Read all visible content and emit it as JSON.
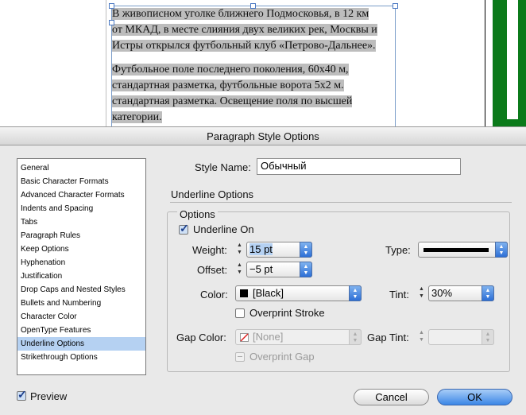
{
  "document": {
    "paragraph1": [
      "В живописном уголке ближнего Подмосковья, в 12 км",
      "от МКАД, в месте слияния двух великих рек, Москвы и",
      "Истры открылся футбольный клуб «Петрово-Дальнее»."
    ],
    "paragraph2": [
      "Футбольное поле последнего поколения, 60х40 м,",
      "стандартная разметка, футбольные ворота 5х2 м.",
      "стандартная разметка. Освещение поля по высшей",
      "категории."
    ]
  },
  "dialog": {
    "title": "Paragraph Style Options",
    "categories": [
      "General",
      "Basic Character Formats",
      "Advanced Character Formats",
      "Indents and Spacing",
      "Tabs",
      "Paragraph Rules",
      "Keep Options",
      "Hyphenation",
      "Justification",
      "Drop Caps and Nested Styles",
      "Bullets and Numbering",
      "Character Color",
      "OpenType Features",
      "Underline Options",
      "Strikethrough Options"
    ],
    "selected_category": "Underline Options",
    "style_name_label": "Style Name:",
    "style_name_value": "Обычный",
    "section_title": "Underline Options",
    "options_title": "Options",
    "underline_on_label": "Underline On",
    "underline_on_checked": true,
    "weight_label": "Weight:",
    "weight_value": "15 pt",
    "type_label": "Type:",
    "offset_label": "Offset:",
    "offset_value": "−5 pt",
    "color_label": "Color:",
    "color_value": "[Black]",
    "tint_label": "Tint:",
    "tint_value": "30%",
    "overprint_stroke_label": "Overprint Stroke",
    "gap_color_label": "Gap Color:",
    "gap_color_value": "[None]",
    "gap_tint_label": "Gap Tint:",
    "overprint_gap_label": "Overprint Gap",
    "preview_label": "Preview",
    "preview_checked": true,
    "cancel_label": "Cancel",
    "ok_label": "OK"
  }
}
